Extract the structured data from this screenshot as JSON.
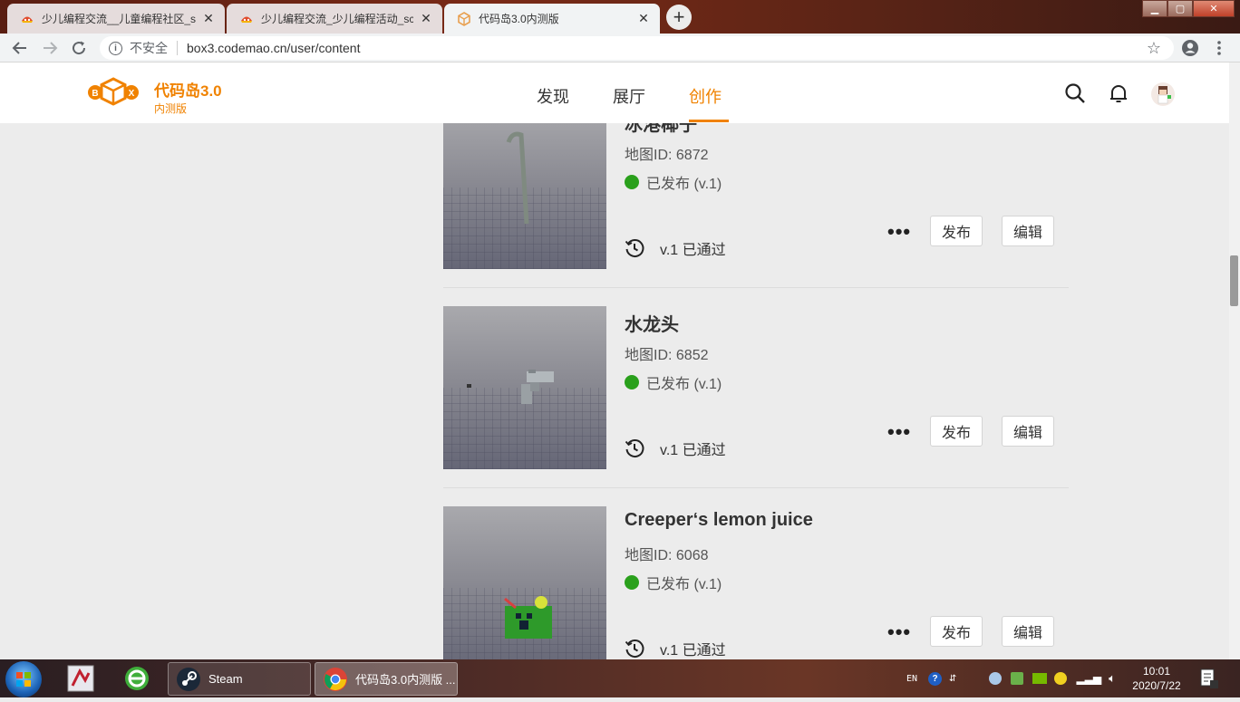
{
  "browser": {
    "tabs": [
      {
        "label": "少儿编程交流__儿童编程社区_scratch"
      },
      {
        "label": "少儿编程交流_少儿编程活动_scratch"
      },
      {
        "label": "代码岛3.0内测版"
      }
    ],
    "url": "box3.codemao.cn/user/content",
    "security_label": "不安全"
  },
  "site": {
    "brand": {
      "title": "代码岛3.0",
      "subtitle": "内测版"
    },
    "nav": [
      {
        "label": "发现"
      },
      {
        "label": "展厅"
      },
      {
        "label": "创作",
        "active": true
      }
    ],
    "accent_color": "#f08200"
  },
  "cards": [
    {
      "title": "冰港椰子",
      "map_id": "地图ID: 6872",
      "status": "已发布 (v.1)",
      "version": "v.1 已通过",
      "more": "•••",
      "publish": "发布",
      "edit": "编辑"
    },
    {
      "title": "水龙头",
      "map_id": "地图ID: 6852",
      "status": "已发布 (v.1)",
      "version": "v.1 已通过",
      "more": "•••",
      "publish": "发布",
      "edit": "编辑"
    },
    {
      "title": "Creeper‘s lemon juice",
      "map_id": "地图ID: 6068",
      "status": "已发布 (v.1)",
      "version": "v.1 已通过",
      "more": "•••",
      "publish": "发布",
      "edit": "编辑"
    }
  ],
  "status_color": "#2aa01c",
  "taskbar": {
    "tasks": [
      {
        "label": "Steam"
      },
      {
        "label": "代码岛3.0内测版 ..."
      }
    ],
    "tray": {
      "lang": "EN"
    },
    "clock": {
      "time": "10:01",
      "date": "2020/7/22"
    }
  }
}
